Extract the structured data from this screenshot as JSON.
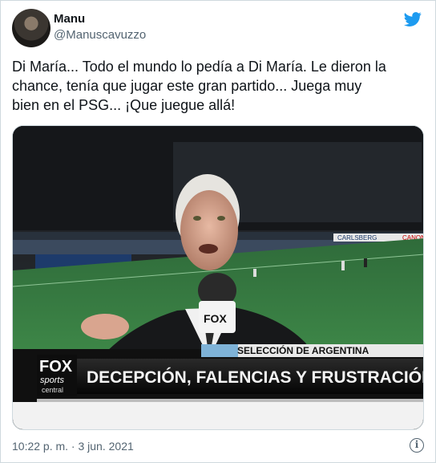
{
  "author": {
    "name": "Manu",
    "handle": "@Manuscavuzzo"
  },
  "tweet": {
    "text_line1": "Di María... Todo el mundo lo pedía a Di María. Le dieron la",
    "text_line2": "chance, tenía que jugar este gran partido... Juega muy",
    "text_line3": "bien en el PSG... ¡Que juegue allá!",
    "timestamp": "10:22 p. m. · 3 jun. 2021"
  },
  "media": {
    "banner_top": "SELECCIÓN DE ARGENTINA",
    "banner_main": "DECEPCIÓN, FALENCIAS Y FRUSTRACIÓN",
    "logo_top": "FOX",
    "logo_bottom": "sports",
    "logo_sub": "central",
    "mic_logo": "FOX",
    "ad_text": "CANON",
    "ad_text2": "CARLSBERG"
  },
  "icons": {
    "bird": "twitter-bird-icon",
    "info": "info-icon"
  },
  "colors": {
    "twitter_blue": "#1d9bf0",
    "text_primary": "#0f1419",
    "text_secondary": "#536471",
    "border": "#cfd9de"
  }
}
